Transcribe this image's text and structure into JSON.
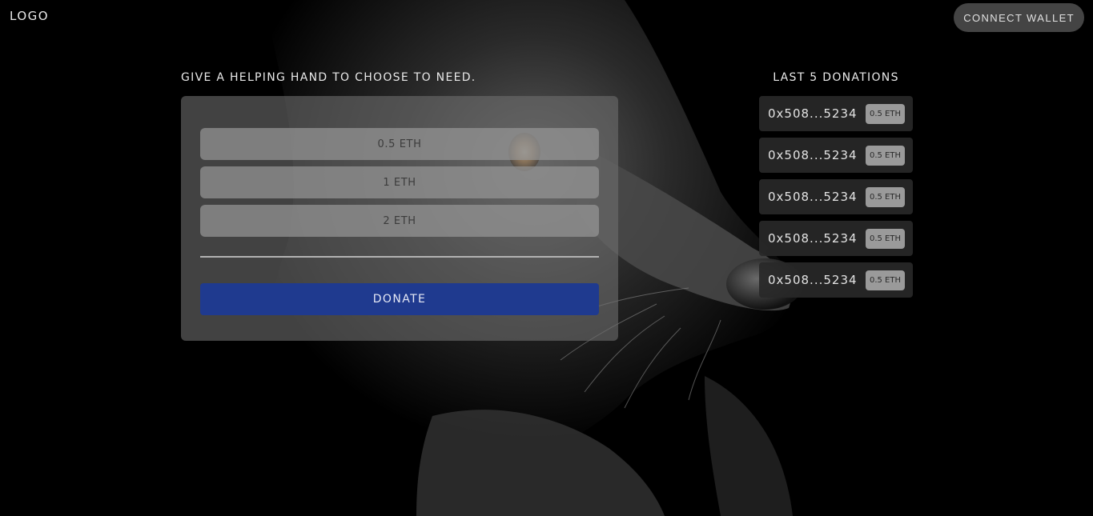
{
  "header": {
    "logo_text": "LOGO",
    "connect_label": "CONNECT WALLET"
  },
  "donate": {
    "heading": "GIVE A HELPING HAND TO CHOOSE TO NEED.",
    "amounts": [
      "0.5 ETH",
      "1 ETH",
      "2 ETH"
    ],
    "submit_label": "DONATE"
  },
  "recent": {
    "heading": "LAST 5 DONATIONS",
    "items": [
      {
        "address": "0x508...5234",
        "amount": "0.5 ETH"
      },
      {
        "address": "0x508...5234",
        "amount": "0.5 ETH"
      },
      {
        "address": "0x508...5234",
        "amount": "0.5 ETH"
      },
      {
        "address": "0x508...5234",
        "amount": "0.5 ETH"
      },
      {
        "address": "0x508...5234",
        "amount": "0.5 ETH"
      }
    ]
  },
  "colors": {
    "background": "#000000",
    "accent": "#1f3a8f",
    "panel": "#6e6e6e",
    "button_secondary": "#444444"
  }
}
